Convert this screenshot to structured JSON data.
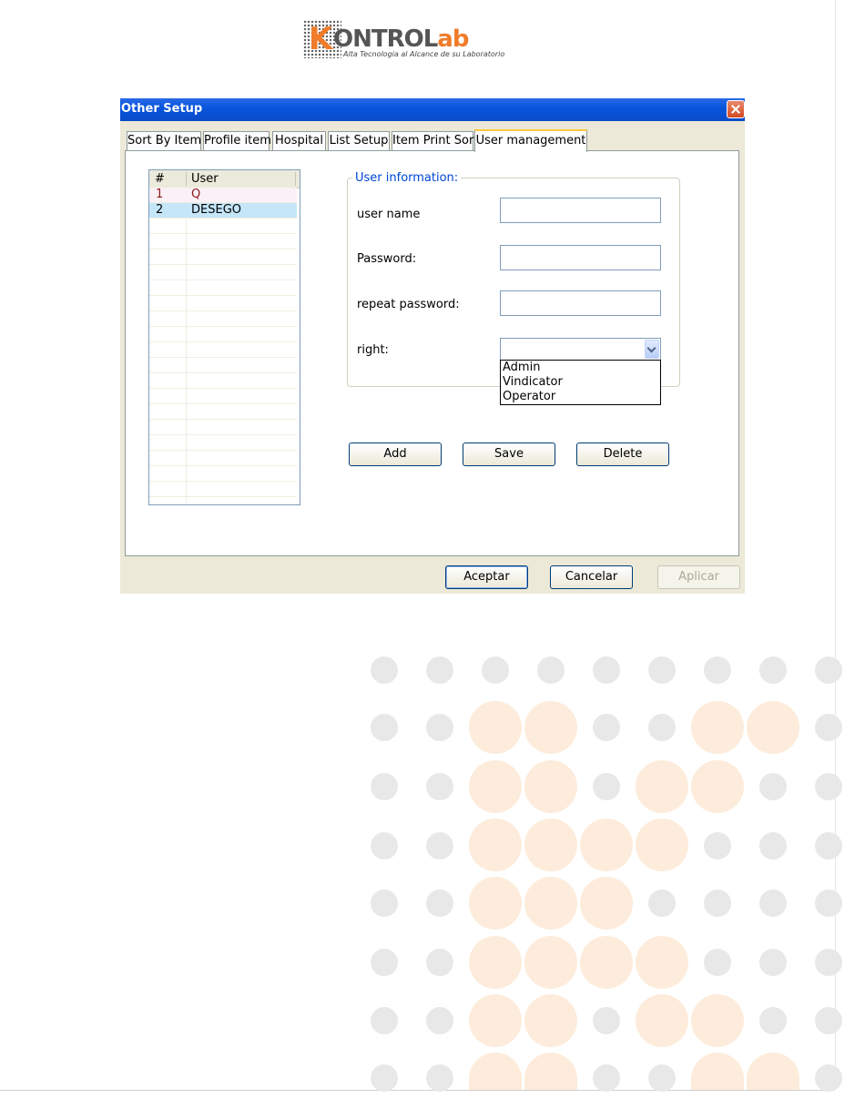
{
  "logo": {
    "brand_part1": "ONTROL",
    "brand_k": "K",
    "brand_part2": "ab",
    "tagline": "Alta Tecnologia al Alcance de su Laboratorio"
  },
  "dialog": {
    "title": "Other Setup",
    "tabs": [
      {
        "label": "Sort By Item"
      },
      {
        "label": "Profile item"
      },
      {
        "label": "Hospital"
      },
      {
        "label": "List Setup"
      },
      {
        "label": "Item Print Sort"
      },
      {
        "label": "User management"
      }
    ],
    "active_tab": "User management",
    "user_list": {
      "columns": [
        "#",
        "User"
      ],
      "rows": [
        {
          "num": "1",
          "user": "Q"
        },
        {
          "num": "2",
          "user": "DESEGO"
        }
      ]
    },
    "user_info": {
      "legend": "User information:",
      "user_name_label": "user name",
      "user_name_value": "",
      "password_label": "Password:",
      "password_value": "",
      "repeat_password_label": "repeat password:",
      "repeat_password_value": "",
      "right_label": "right:",
      "right_value": "",
      "right_options": [
        "Admin",
        "Vindicator",
        "Operator"
      ]
    },
    "actions": {
      "add": "Add",
      "save": "Save",
      "delete": "Delete"
    },
    "footer": {
      "ok": "Aceptar",
      "cancel": "Cancelar",
      "apply": "Aplicar"
    }
  },
  "colors": {
    "titlebar": "#0a4cc8",
    "legend_text": "#0046d5",
    "selected_row": "#c4e6f8",
    "active_tab_accent": "#ffc83c",
    "deco_grey": "#e8e8e8",
    "deco_orange": "#fdecdb"
  }
}
